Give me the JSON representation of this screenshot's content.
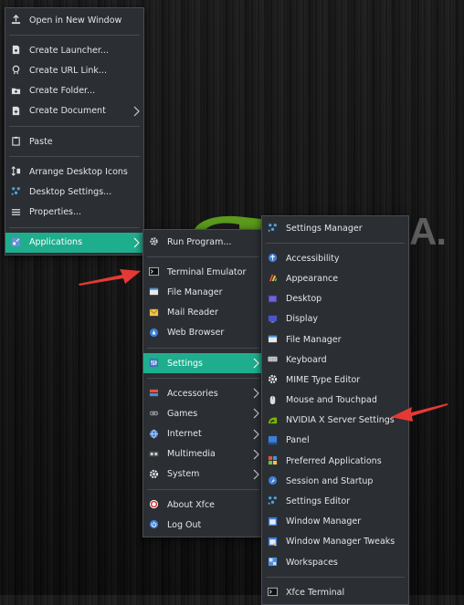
{
  "wallpaper": {
    "logo_text": "A."
  },
  "desktop_menu": {
    "open_new_window": "Open in New Window",
    "create_launcher": "Create Launcher...",
    "create_url_link": "Create URL Link...",
    "create_folder": "Create Folder...",
    "create_document": "Create Document",
    "paste": "Paste",
    "arrange_icons": "Arrange Desktop Icons",
    "desktop_settings": "Desktop Settings...",
    "properties": "Properties...",
    "applications": "Applications"
  },
  "apps_menu": {
    "run_program": "Run Program...",
    "terminal_emulator": "Terminal Emulator",
    "file_manager": "File Manager",
    "mail_reader": "Mail Reader",
    "web_browser": "Web Browser",
    "settings": "Settings",
    "accessories": "Accessories",
    "games": "Games",
    "internet": "Internet",
    "multimedia": "Multimedia",
    "system": "System",
    "about_xfce": "About Xfce",
    "log_out": "Log Out"
  },
  "settings_menu": {
    "settings_manager": "Settings Manager",
    "accessibility": "Accessibility",
    "appearance": "Appearance",
    "desktop": "Desktop",
    "display": "Display",
    "file_manager": "File Manager",
    "keyboard": "Keyboard",
    "mime_editor": "MIME Type Editor",
    "mouse_touchpad": "Mouse and Touchpad",
    "nvidia_settings": "NVIDIA X Server Settings",
    "panel": "Panel",
    "preferred_apps": "Preferred Applications",
    "session_startup": "Session and Startup",
    "settings_editor": "Settings Editor",
    "window_manager": "Window Manager",
    "wm_tweaks": "Window Manager Tweaks",
    "workspaces": "Workspaces",
    "xfce_terminal": "Xfce Terminal"
  },
  "colors": {
    "highlight": "#1eae8e",
    "menu_bg": "#2b2e33",
    "annotation_arrow": "#e53935"
  }
}
